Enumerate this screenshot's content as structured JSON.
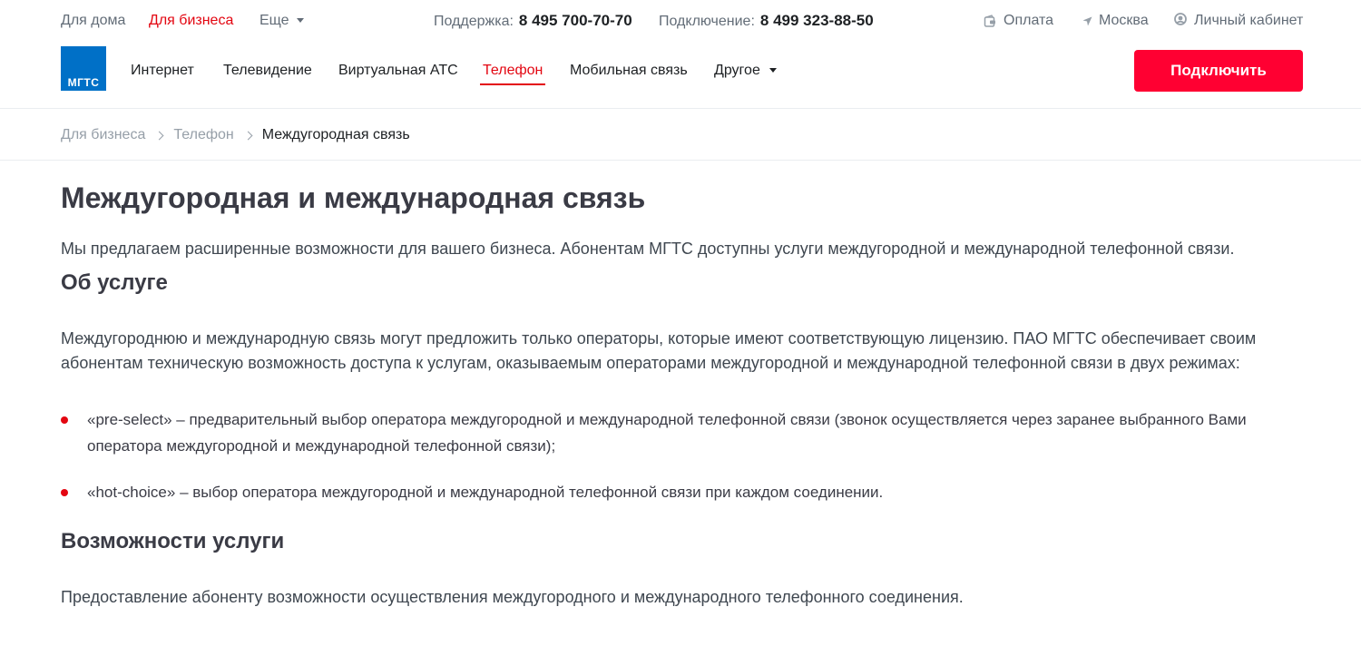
{
  "topbar": {
    "home": "Для дома",
    "business": "Для бизнеса",
    "more": "Еще",
    "support_label": "Поддержка:",
    "support_phone": "8 495 700-70-70",
    "connect_label": "Подключение:",
    "connect_phone": "8 499 323-88-50",
    "pay": "Оплата",
    "city": "Москва",
    "cabinet": "Личный кабинет"
  },
  "brand": {
    "logo_text": "МГТС",
    "color": "#0070c7"
  },
  "nav": {
    "items": [
      {
        "label": "Интернет"
      },
      {
        "label": "Телевидение"
      },
      {
        "label": "Виртуальная АТС"
      },
      {
        "label": "Телефон",
        "active": true
      },
      {
        "label": "Мобильная связь"
      },
      {
        "label": "Другое"
      }
    ],
    "cta": "Подключить"
  },
  "breadcrumb": [
    "Для бизнеса",
    "Телефон",
    "Междугородная связь"
  ],
  "main": {
    "title": "Междугородная и международная связь",
    "lead": "Мы предлагаем расширенные возможности для вашего бизнеса. Абонентам МГТС доступны услуги междугородной и международной телефонной связи.",
    "section1_title": "Об услуге",
    "section1_text": "Междугороднюю и международную связь могут предложить только операторы, которые имеют соответствующую лицензию. ПАО МГТС обеспечивает своим абонентам техническую возможность доступа к услугам, оказываемым операторами междугородной и международной телефонной связи в двух режимах:",
    "bullets": [
      "«pre-select» – предварительный выбор оператора междугородной и международной телефонной связи (звонок осуществляется через заранее выбранного Вами оператора междугородной и международной телефонной связи);",
      "«hot-choice» – выбор оператора междугородной и международной телефонной связи при каждом соединении."
    ],
    "section2_title": "Возможности услуги",
    "section2_text": "Предоставление абоненту возможности осуществления междугородного и международного телефонного соединения."
  },
  "colors": {
    "accent": "#e30611",
    "cta": "#ff0032",
    "text": "#3a3b45"
  },
  "icons": {
    "pay": "wallet-icon",
    "city": "location-arrow-icon",
    "cabinet": "user-icon"
  }
}
